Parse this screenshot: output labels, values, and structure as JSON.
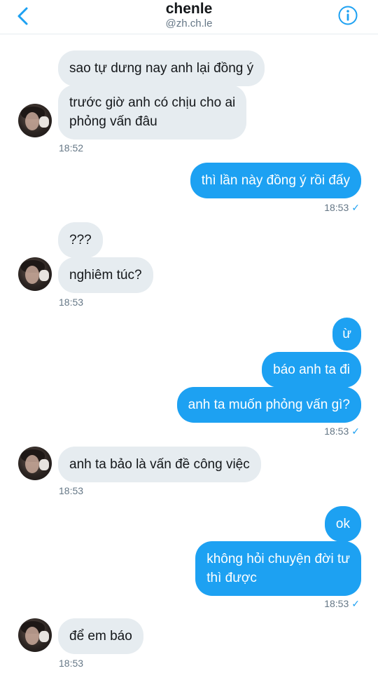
{
  "header": {
    "title": "chenle",
    "handle": "@zh.ch.le"
  },
  "icons": {
    "back": "chevron-left-icon",
    "info": "info-icon"
  },
  "colors": {
    "accent": "#1da1f2",
    "incoming_bubble": "#e6ecf0",
    "muted_text": "#657786"
  },
  "messages": [
    {
      "text": "sao tự dưng nay anh lại đồng ý"
    },
    {
      "line1": "trước giờ anh có chịu cho ai",
      "line2": "phỏng vấn đâu"
    },
    {
      "text": "thì lần này đồng ý rồi đấy"
    },
    {
      "text": "???"
    },
    {
      "text": "nghiêm túc?"
    },
    {
      "text": "ừ"
    },
    {
      "text": "báo anh ta đi"
    },
    {
      "text": "anh ta muốn phỏng vấn gì?"
    },
    {
      "text": "anh ta bảo là vấn đề công việc"
    },
    {
      "text": "ok"
    },
    {
      "line1": "không hỏi chuyện đời tư",
      "line2": "thì được"
    },
    {
      "text": "để em báo"
    }
  ],
  "timestamps": [
    "18:52",
    "18:53",
    "18:53",
    "18:53",
    "18:53",
    "18:53",
    "18:53"
  ],
  "read_mark": "✓"
}
